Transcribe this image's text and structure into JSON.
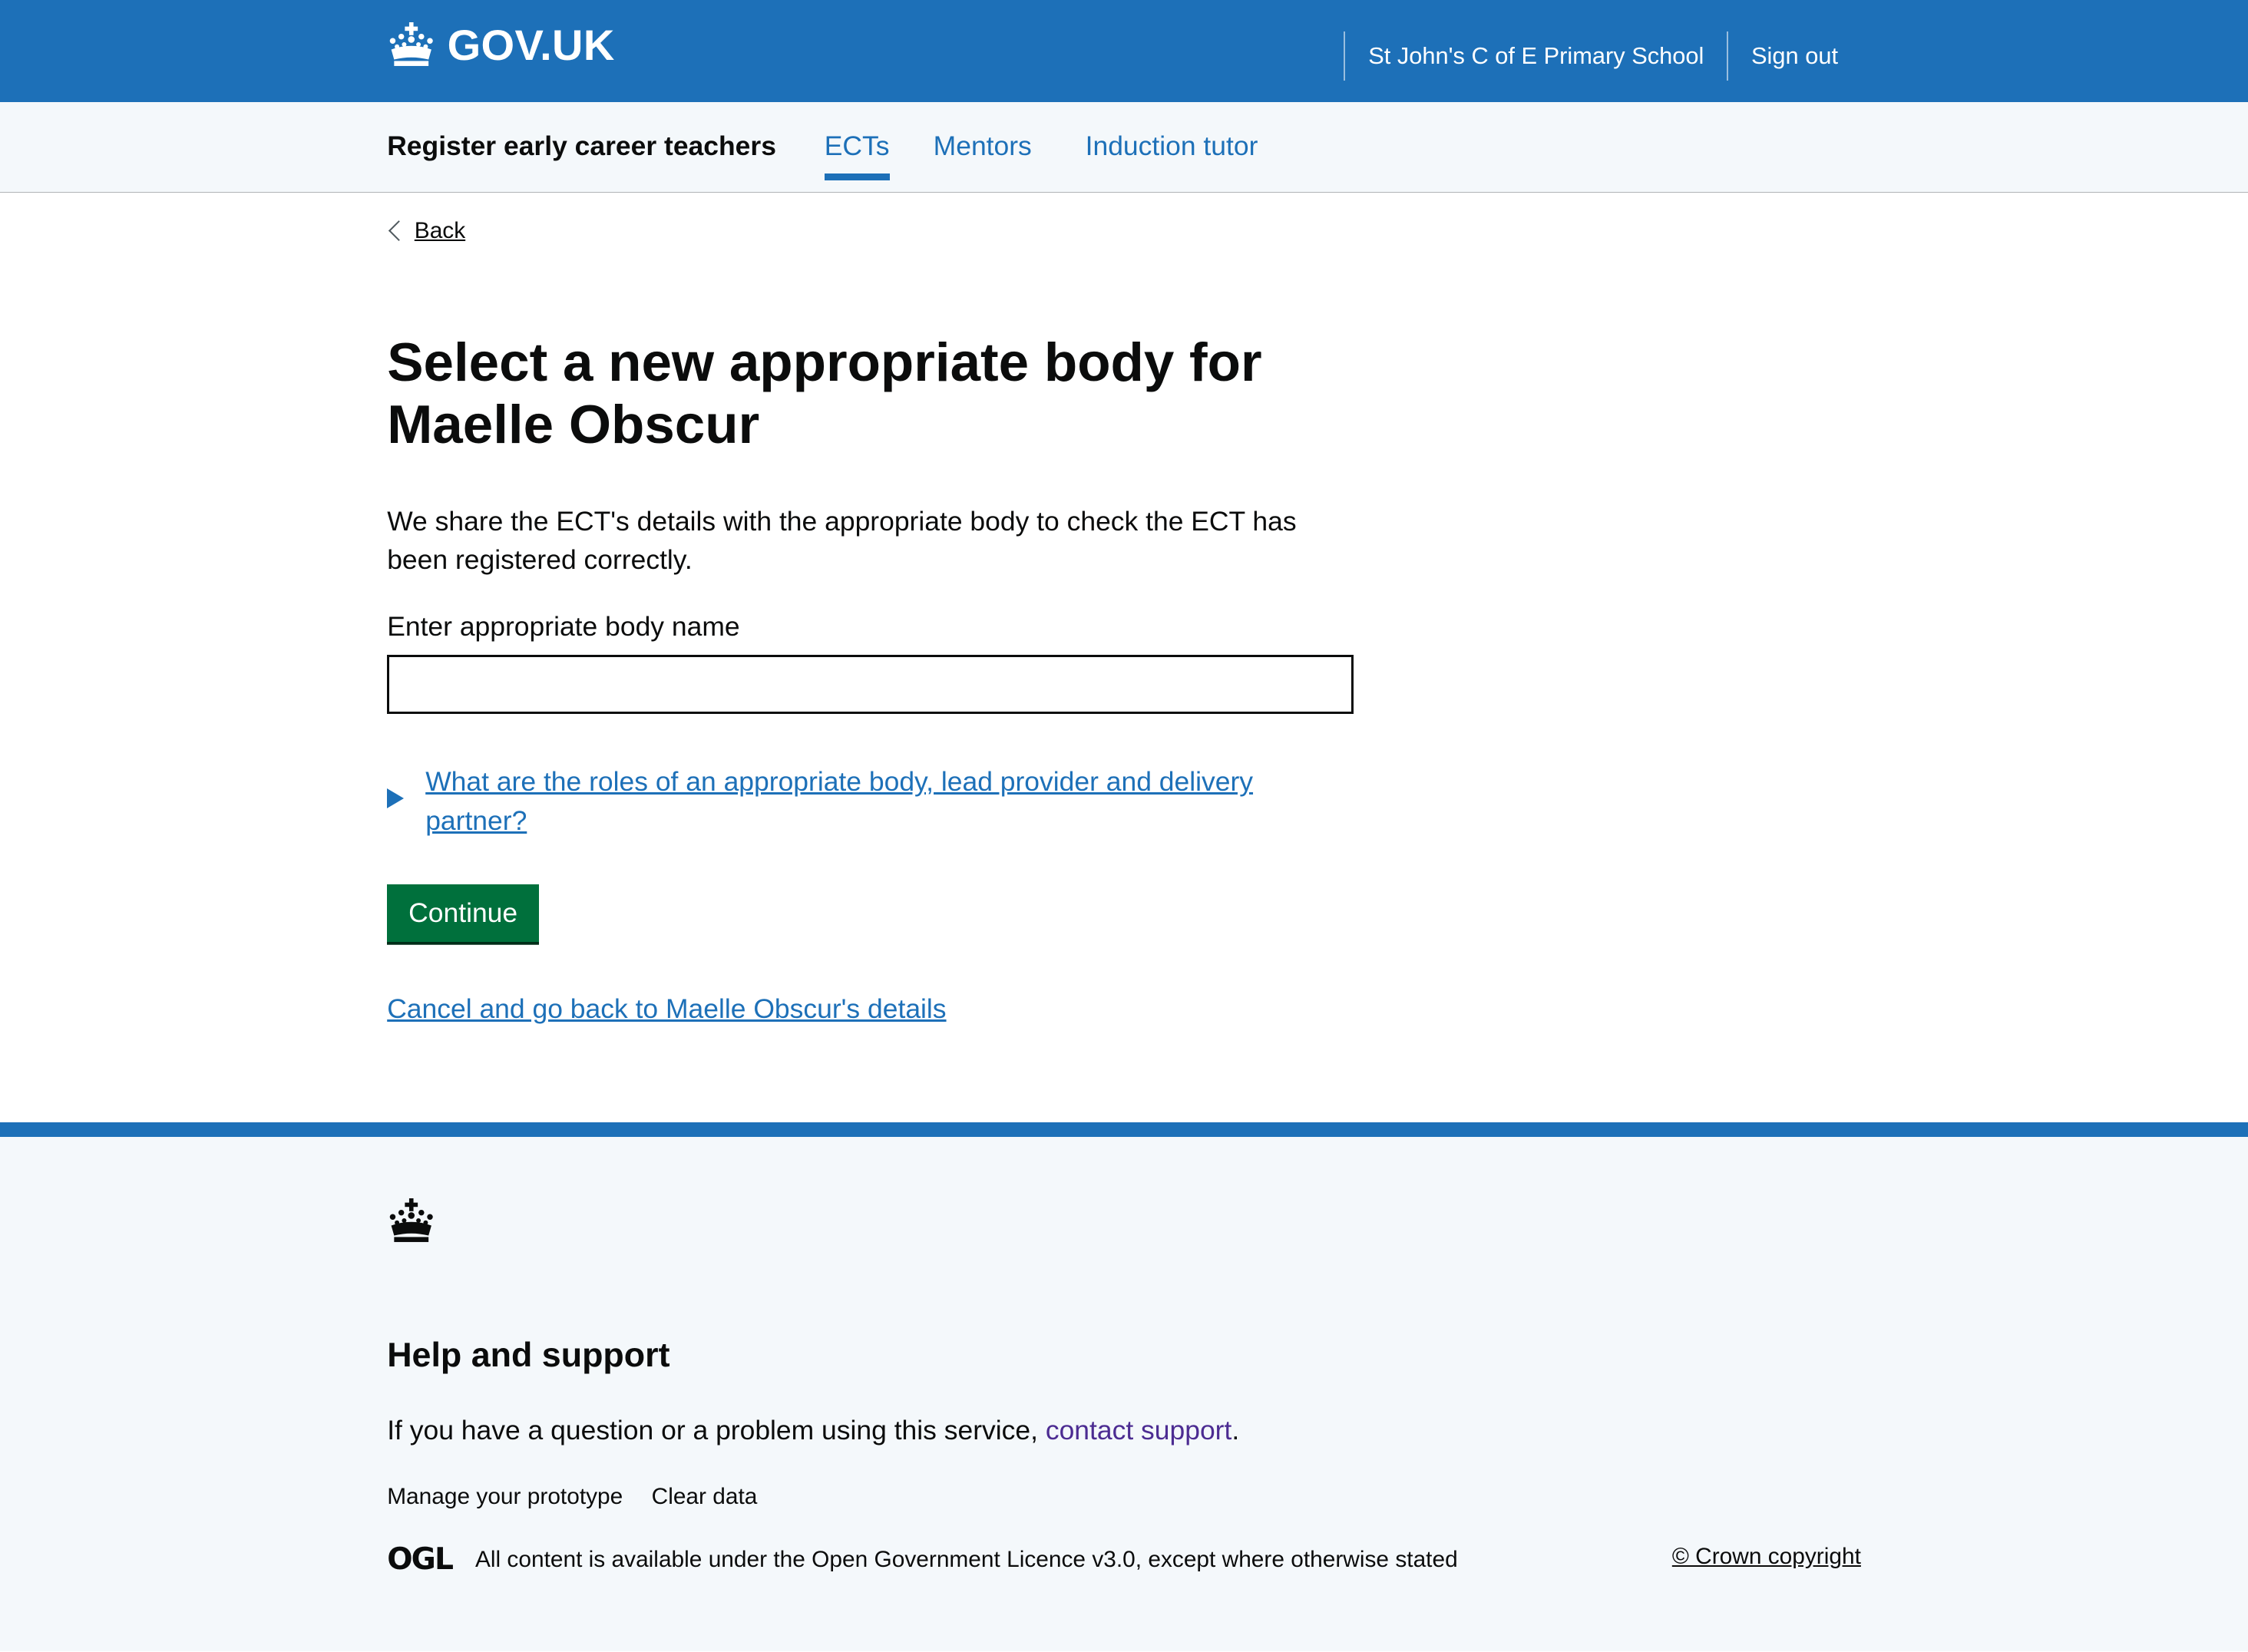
{
  "header": {
    "logo_text": "GOV.UK",
    "school": "St John's C of E Primary School",
    "sign_out": "Sign out"
  },
  "service_nav": {
    "service_name": "Register early career teachers",
    "items": [
      {
        "label": "ECTs",
        "active": true
      },
      {
        "label": "Mentors",
        "active": false
      },
      {
        "label": "Induction tutor",
        "active": false
      }
    ]
  },
  "back_link": "Back",
  "page": {
    "title": "Select a new appropriate body for Maelle Obscur",
    "lead": "We share the ECT's details with the appropriate body to check the ECT has been registered correctly.",
    "input_label": "Enter appropriate body name",
    "input_value": "",
    "details_summary": "What are the roles of an appropriate body, lead provider and delivery partner?",
    "continue_button": "Continue",
    "cancel_link": "Cancel and go back to Maelle Obscur's details"
  },
  "footer": {
    "help_title": "Help and support",
    "help_text_prefix": "If you have a question or a problem using this service,",
    "help_link": "contact support",
    "help_text_suffix": ".",
    "links": [
      "Manage your prototype",
      "Clear data"
    ],
    "ogl_logo": "OGL",
    "licence_prefix": "All content is available under the",
    "licence_link": "Open Government Licence v3.0",
    "licence_suffix": ", except where otherwise stated",
    "copyright": "© Crown copyright"
  },
  "colors": {
    "brand_blue": "#1d70b8",
    "button_green": "#00703c",
    "text": "#0b0c0c",
    "footer_bg": "#f4f8fb",
    "visited_link": "#4c2c92"
  }
}
